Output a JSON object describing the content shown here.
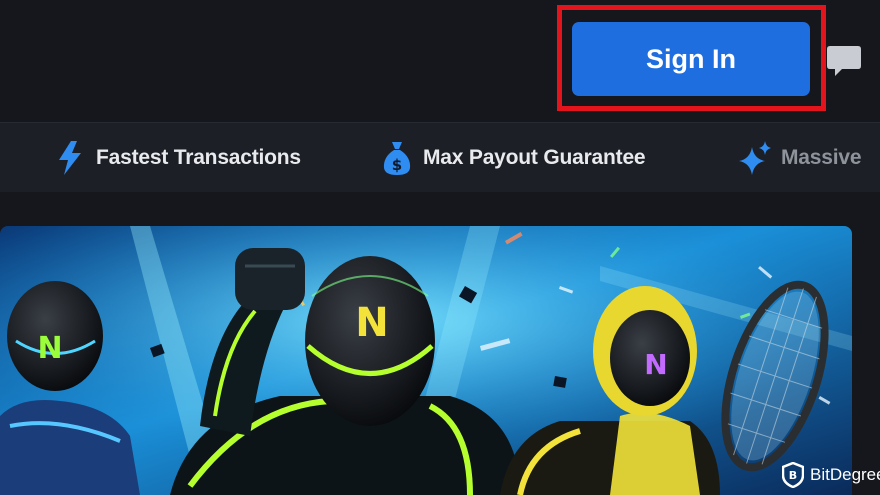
{
  "header": {
    "sign_in_label": "Sign In"
  },
  "features": [
    {
      "icon": "lightning-bolt-icon",
      "label": "Fastest Transactions"
    },
    {
      "icon": "money-bag-icon",
      "label": "Max Payout Guarantee"
    },
    {
      "icon": "sparkle-icon",
      "label": "Massive"
    }
  ],
  "watermark": {
    "text": "BitDegree"
  },
  "colors": {
    "background": "#15171d",
    "feature_bar": "#1c1f26",
    "accent_blue": "#1e6ee0",
    "highlight_red": "#e3141c",
    "neon_green": "#b6ff2e",
    "neon_yellow": "#f2e23a"
  }
}
